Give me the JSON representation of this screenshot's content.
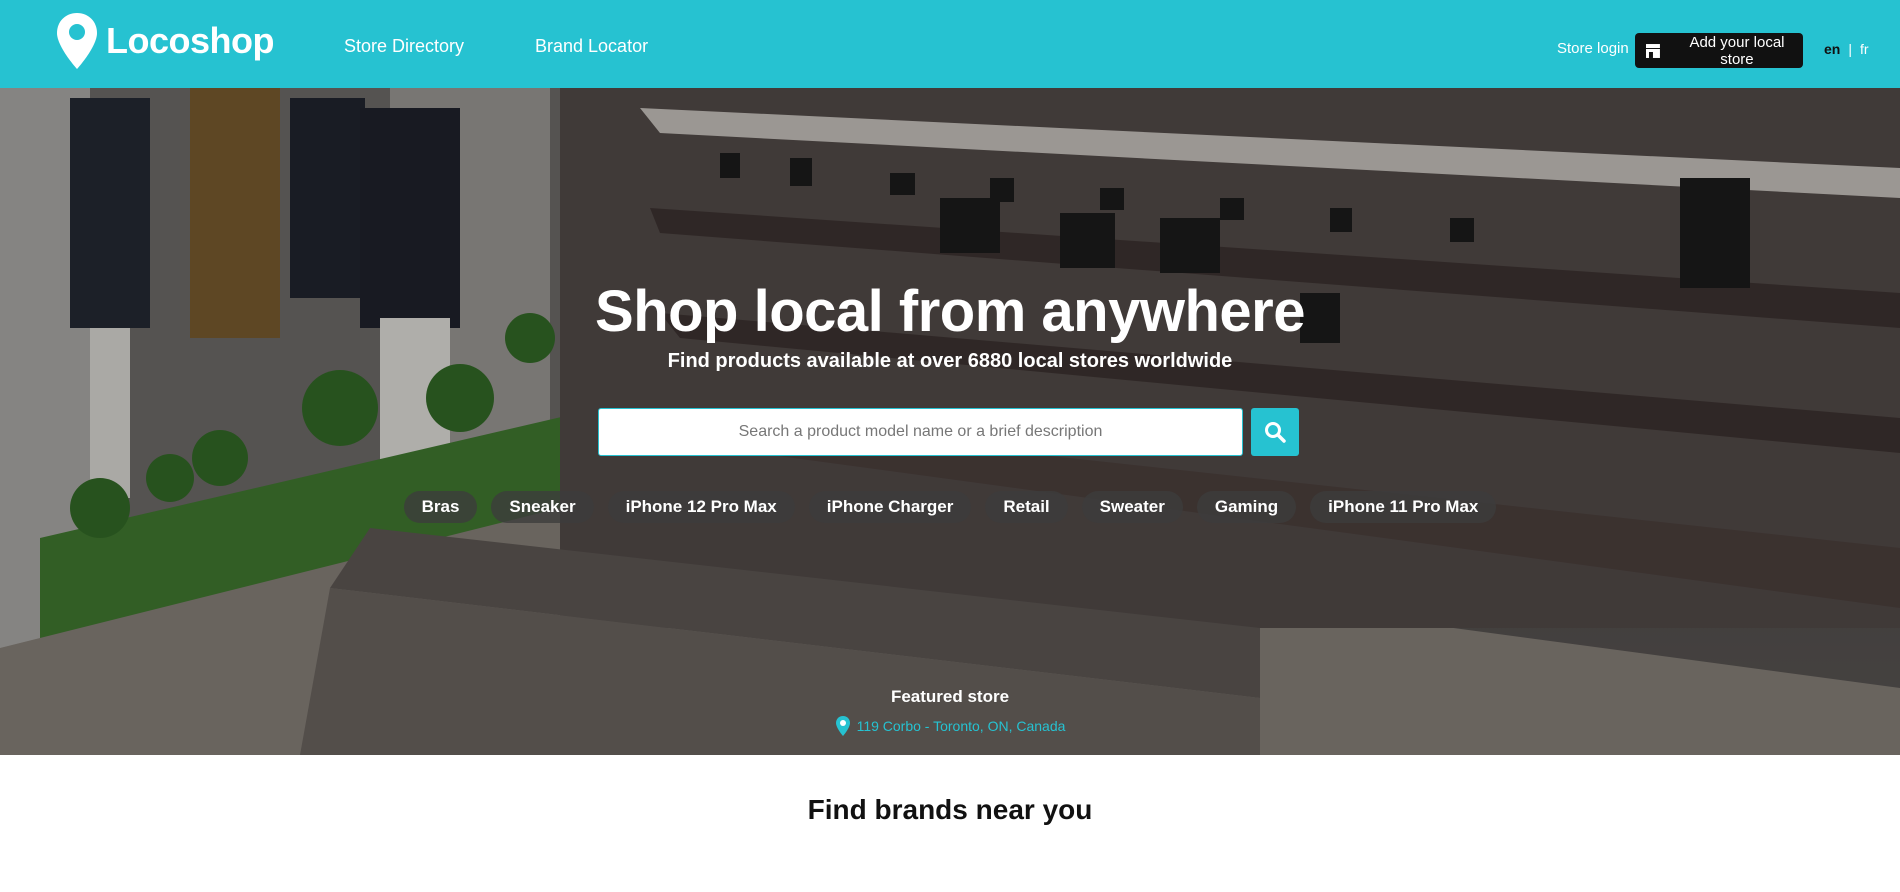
{
  "header": {
    "logo_text": "Locoshop",
    "nav": [
      "Store Directory",
      "Brand Locator"
    ],
    "store_login": "Store login",
    "add_store": "Add your local store",
    "lang_selected": "en",
    "lang_separator": "|",
    "lang_other": "fr",
    "icons": [
      "map-pin-icon",
      "store-icon"
    ]
  },
  "hero": {
    "title": "Shop local from anywhere",
    "subtitle": "Find products available at over 6880 local stores worldwide",
    "search_placeholder": "Search a product model name or a brief description",
    "search_icon": "search-icon",
    "tags": [
      "Bras",
      "Sneaker",
      "iPhone 12 Pro Max",
      "iPhone Charger",
      "Retail",
      "Sweater",
      "Gaming",
      "iPhone 11 Pro Max"
    ],
    "featured_label": "Featured store",
    "featured_address": "119 Corbo - Toronto, ON, Canada"
  },
  "brands": {
    "title": "Find brands near you"
  },
  "colors": {
    "accent": "#26c2d1",
    "button_dark": "#111111",
    "tag_bg": "rgba(60,60,60,0.78)"
  }
}
